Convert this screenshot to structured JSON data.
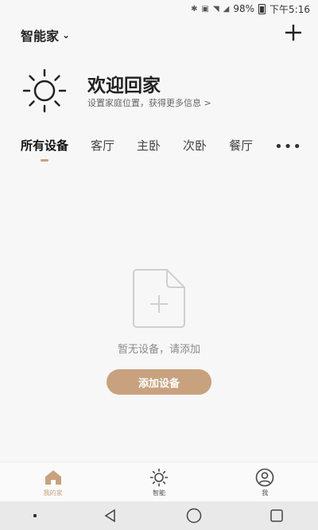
{
  "status_bar": {
    "battery": "98%",
    "time": "下午5:16"
  },
  "header": {
    "home_name": "智能家"
  },
  "welcome": {
    "title": "欢迎回家",
    "subtitle": "设置家庭位置，获得更多信息 >"
  },
  "tabs": [
    {
      "label": "所有设备"
    },
    {
      "label": "客厅"
    },
    {
      "label": "主卧"
    },
    {
      "label": "次卧"
    },
    {
      "label": "餐厅"
    }
  ],
  "empty_state": {
    "text": "暂无设备，请添加",
    "button_label": "添加设备"
  },
  "bottom_nav": [
    {
      "label": "我的家",
      "icon": "home-icon"
    },
    {
      "label": "智能",
      "icon": "sun-icon"
    },
    {
      "label": "我",
      "icon": "user-icon"
    }
  ],
  "colors": {
    "accent": "#c8a27e"
  }
}
